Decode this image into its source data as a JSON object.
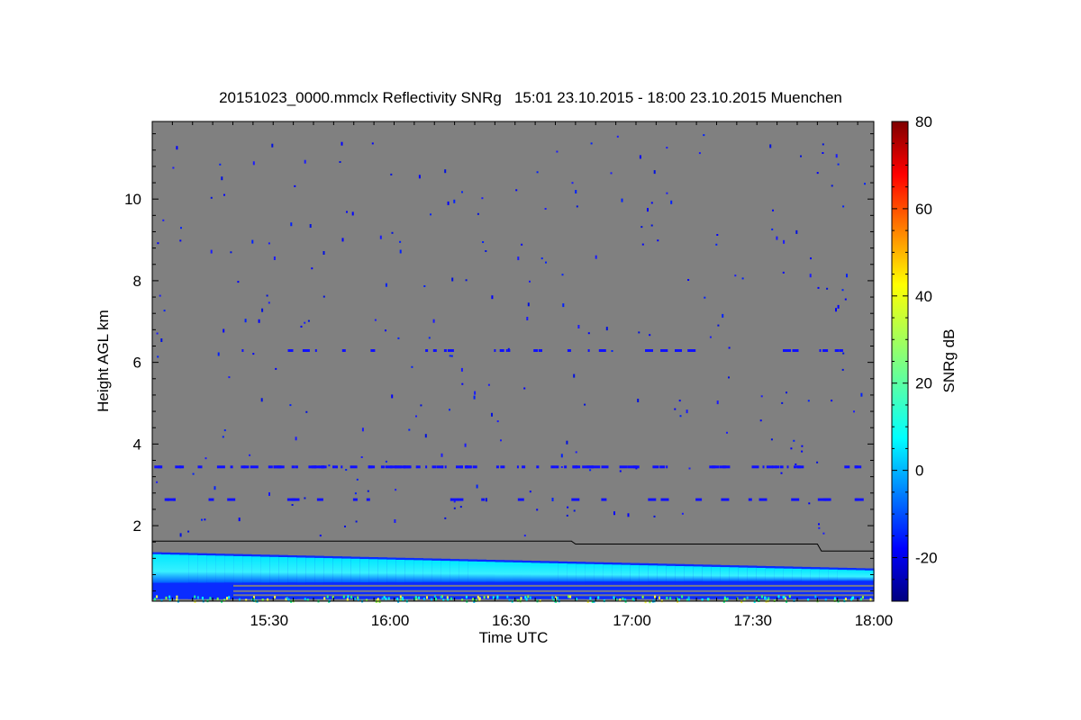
{
  "chart_data": {
    "type": "heatmap",
    "title": "20151023_0000.mmclx Reflectivity SNRg   15:01 23.10.2015 - 18:00 23.10.2015 Muenchen",
    "xlabel": "Time UTC",
    "ylabel": "Height AGL km",
    "x_ticks": [
      "15:30",
      "16:00",
      "16:30",
      "17:00",
      "17:30",
      "18:00"
    ],
    "y_ticks": [
      "2",
      "4",
      "6",
      "8",
      "10"
    ],
    "xlim": [
      "15:01",
      "18:00"
    ],
    "ylim_km": [
      0.15,
      11.9
    ],
    "background_color": "#808080",
    "colorbar": {
      "label": "SNRg dB",
      "range": [
        -30,
        80
      ],
      "ticks": [
        "-20",
        "0",
        "20",
        "40",
        "60",
        "80"
      ],
      "colormap": "jet"
    },
    "cloud_layer": {
      "description_base_km": 0.2,
      "top_km_at_start": 1.35,
      "top_km_at_end": 0.95,
      "peak_snr_db": 10
    },
    "boundary_line": [
      {
        "time": "15:01",
        "height_km": 1.62
      },
      {
        "time": "16:45",
        "height_km": 1.62
      },
      {
        "time": "16:46",
        "height_km": 1.55
      },
      {
        "time": "17:46",
        "height_km": 1.55
      },
      {
        "time": "17:47",
        "height_km": 1.38
      },
      {
        "time": "18:00",
        "height_km": 1.38
      }
    ],
    "noise_bands_km": [
      3.45,
      6.3,
      2.65
    ],
    "grid": false,
    "legend": "colorbar-right"
  }
}
